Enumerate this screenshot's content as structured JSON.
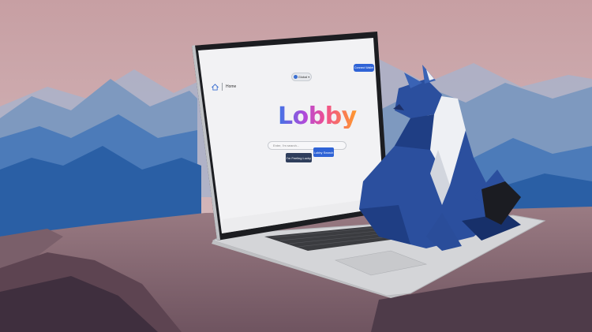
{
  "nav": {
    "home_label": "Home",
    "home_icon": "home-icon"
  },
  "region": {
    "selected": "Global",
    "icon": "globe-icon"
  },
  "header": {
    "connect_label": "Connect Wallet"
  },
  "hero": {
    "logo_text": "Lobby"
  },
  "search": {
    "placeholder": "Enter, I'm search...",
    "lucky_label": "I'm Feeling Lucky",
    "search_label": "Lobby Search"
  },
  "colors": {
    "sky_top": "#c9a7a9",
    "mountains_far": "#8fa4c2",
    "mountains_near": "#2a5fa5",
    "ground": "#8c6b74",
    "laptop_body": "#d9dadc",
    "screen_bg": "#f2f2f4",
    "fox_blue": "#2b4f9e",
    "fox_white": "#eef0f4",
    "accent_blue": "#2f63d6"
  }
}
